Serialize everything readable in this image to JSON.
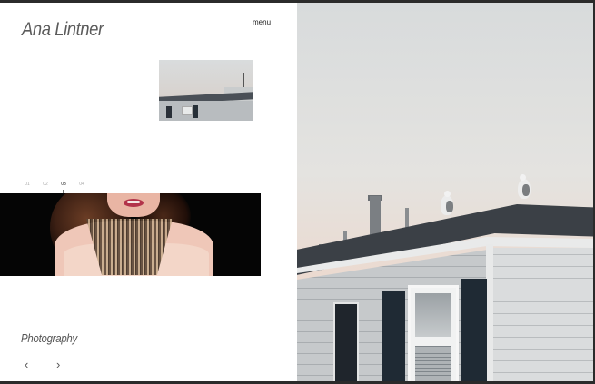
{
  "header": {
    "brand": "Ana Lintner",
    "menu_label": "menu"
  },
  "slider": {
    "indicators": [
      {
        "label": "01",
        "active": false
      },
      {
        "label": "02",
        "active": false
      },
      {
        "label": "03",
        "active": true
      },
      {
        "label": "04",
        "active": false
      }
    ]
  },
  "gallery": {
    "category": "Photography",
    "prev_icon": "chevron-left-icon",
    "next_icon": "chevron-right-icon",
    "prev_glyph": "‹",
    "next_glyph": "›"
  },
  "colors": {
    "background": "#2b2b2b",
    "panel": "#ffffff",
    "text": "#555555"
  }
}
